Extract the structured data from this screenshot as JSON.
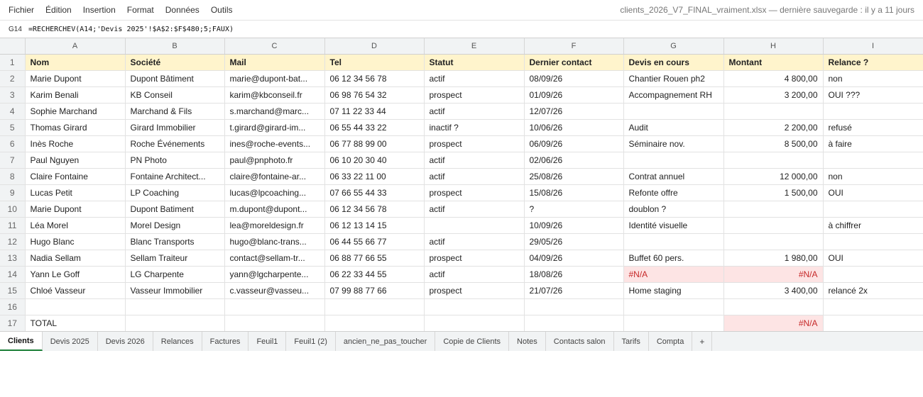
{
  "menu": [
    "Fichier",
    "Édition",
    "Insertion",
    "Format",
    "Données",
    "Outils"
  ],
  "doc_title": "clients_2026_V7_FINAL_vraiment.xlsx — dernière sauvegarde : il y a 11 jours",
  "formula_bar": {
    "cell_ref": "G14",
    "formula": "=RECHERCHEV(A14;'Devis 2025'!$A$2:$F$480;5;FAUX)"
  },
  "columns": [
    "A",
    "B",
    "C",
    "D",
    "E",
    "F",
    "G",
    "H",
    "I"
  ],
  "header_row": {
    "num": "1",
    "cells": [
      "Nom",
      "Société",
      "Mail",
      "Tel",
      "Statut",
      "Dernier contact",
      "Devis en cours",
      "Montant",
      "Relance ?"
    ]
  },
  "rows": [
    {
      "num": "2",
      "cells": [
        "Marie Dupont",
        "Dupont Bâtiment",
        "marie@dupont-bat...",
        "06 12 34 56 78",
        "actif",
        "08/09/26",
        "Chantier Rouen ph2",
        "4 800,00",
        "non"
      ]
    },
    {
      "num": "3",
      "cells": [
        "Karim Benali",
        "KB Conseil",
        "karim@kbconseil.fr",
        "06 98 76 54 32",
        "prospect",
        "01/09/26",
        "Accompagnement RH",
        "3 200,00",
        "OUI ???"
      ]
    },
    {
      "num": "4",
      "cells": [
        "Sophie Marchand",
        "Marchand & Fils",
        "s.marchand@marc...",
        "07 11 22 33 44",
        "actif",
        "12/07/26",
        "",
        "",
        ""
      ]
    },
    {
      "num": "5",
      "cells": [
        "Thomas Girard",
        "Girard Immobilier",
        "t.girard@girard-im...",
        "06 55 44 33 22",
        "inactif ?",
        "10/06/26",
        "Audit",
        "2 200,00",
        "refusé"
      ]
    },
    {
      "num": "6",
      "cells": [
        "Inès Roche",
        "Roche Événements",
        "ines@roche-events...",
        "06 77 88 99 00",
        "prospect",
        "06/09/26",
        "Séminaire nov.",
        "8 500,00",
        "à faire"
      ]
    },
    {
      "num": "7",
      "cells": [
        "Paul Nguyen",
        "PN Photo",
        "paul@pnphoto.fr",
        "06 10 20 30 40",
        "actif",
        "02/06/26",
        "",
        "",
        ""
      ]
    },
    {
      "num": "8",
      "cells": [
        "Claire Fontaine",
        "Fontaine Architect...",
        "claire@fontaine-ar...",
        "06 33 22 11 00",
        "actif",
        "25/08/26",
        "Contrat annuel",
        "12 000,00",
        "non"
      ]
    },
    {
      "num": "9",
      "cells": [
        "Lucas Petit",
        "LP Coaching",
        "lucas@lpcoaching...",
        "07 66 55 44 33",
        "prospect",
        "15/08/26",
        "Refonte offre",
        "1 500,00",
        "OUI"
      ]
    },
    {
      "num": "10",
      "cells": [
        "Marie Dupont",
        "Dupont Batiment",
        "m.dupont@dupont...",
        "06 12 34 56 78",
        "actif",
        "?",
        "doublon ?",
        "",
        ""
      ]
    },
    {
      "num": "11",
      "cells": [
        "Léa Morel",
        "Morel Design",
        "lea@moreldesign.fr",
        "06 12 13 14 15",
        "",
        "10/09/26",
        "Identité visuelle",
        "",
        "à chiffrer"
      ]
    },
    {
      "num": "12",
      "cells": [
        "Hugo Blanc",
        "Blanc Transports",
        "hugo@blanc-trans...",
        "06 44 55 66 77",
        "actif",
        "29/05/26",
        "",
        "",
        ""
      ]
    },
    {
      "num": "13",
      "cells": [
        "Nadia Sellam",
        "Sellam Traiteur",
        "contact@sellam-tr...",
        "06 88 77 66 55",
        "prospect",
        "04/09/26",
        "Buffet 60 pers.",
        "1 980,00",
        "OUI"
      ]
    },
    {
      "num": "14",
      "cells": [
        "Yann Le Goff",
        "LG Charpente",
        "yann@lgcharpente...",
        "06 22 33 44 55",
        "actif",
        "18/08/26",
        "#N/A",
        "#N/A",
        ""
      ]
    },
    {
      "num": "15",
      "cells": [
        "Chloé Vasseur",
        "Vasseur Immobilier",
        "c.vasseur@vasseu...",
        "07 99 88 77 66",
        "prospect",
        "21/07/26",
        "Home staging",
        "3 400,00",
        "relancé 2x"
      ]
    },
    {
      "num": "16",
      "cells": [
        "",
        "",
        "",
        "",
        "",
        "",
        "",
        "",
        ""
      ]
    },
    {
      "num": "17",
      "cells": [
        "TOTAL",
        "",
        "",
        "",
        "",
        "",
        "",
        "#N/A",
        ""
      ]
    }
  ],
  "error_color": "#c62828",
  "header_fill": "#fff4cc",
  "sheet_tabs": [
    {
      "label": "Clients",
      "active": true
    },
    {
      "label": "Devis 2025"
    },
    {
      "label": "Devis 2026"
    },
    {
      "label": "Relances"
    },
    {
      "label": "Factures"
    },
    {
      "label": "Feuil1"
    },
    {
      "label": "Feuil1 (2)"
    },
    {
      "label": "ancien_ne_pas_toucher"
    },
    {
      "label": "Copie de Clients"
    },
    {
      "label": "Notes"
    },
    {
      "label": "Contacts salon"
    },
    {
      "label": "Tarifs"
    },
    {
      "label": "Compta"
    }
  ],
  "add_sheet_label": "+"
}
